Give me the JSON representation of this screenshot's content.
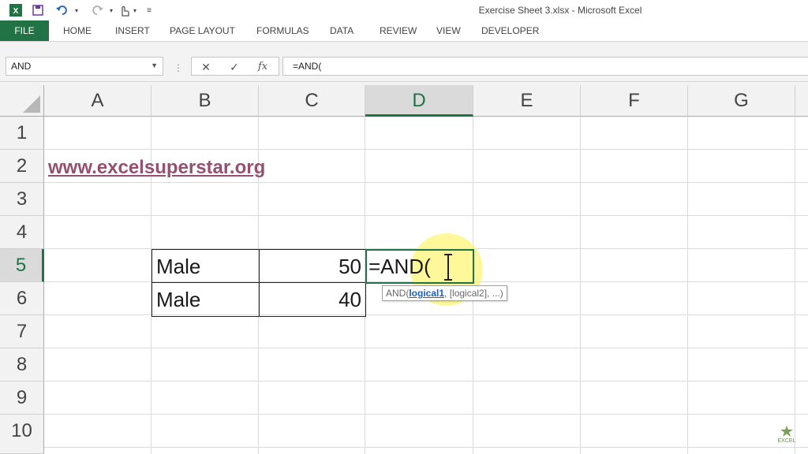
{
  "window": {
    "title": "Exercise Sheet 3.xlsx - Microsoft Excel"
  },
  "ribbon": {
    "tabs": [
      {
        "label": "FILE"
      },
      {
        "label": "HOME"
      },
      {
        "label": "INSERT"
      },
      {
        "label": "PAGE LAYOUT"
      },
      {
        "label": "FORMULAS"
      },
      {
        "label": "DATA"
      },
      {
        "label": "REVIEW"
      },
      {
        "label": "VIEW"
      },
      {
        "label": "DEVELOPER"
      }
    ]
  },
  "formula_bar": {
    "name_box": "AND",
    "content": "=AND(",
    "fx_label": "fx"
  },
  "grid": {
    "columns": [
      "A",
      "B",
      "C",
      "D",
      "E",
      "F",
      "G"
    ],
    "rows": [
      "1",
      "2",
      "3",
      "4",
      "5",
      "6",
      "7",
      "8",
      "9",
      "10"
    ],
    "active_column": "D",
    "active_row": "5",
    "cells": {
      "A2": "www.excelsuperstar.org",
      "B5": "Male",
      "C5": "50",
      "D5": "=AND(",
      "B6": "Male",
      "C6": "40"
    }
  },
  "tooltip": {
    "func": "AND(",
    "arg1": "logical1",
    "rest": ", [logical2], ...)"
  },
  "watermark": {
    "text": "EXCEL"
  },
  "colors": {
    "accent": "#217346",
    "link": "#954f72",
    "highlight": "#fff578"
  }
}
